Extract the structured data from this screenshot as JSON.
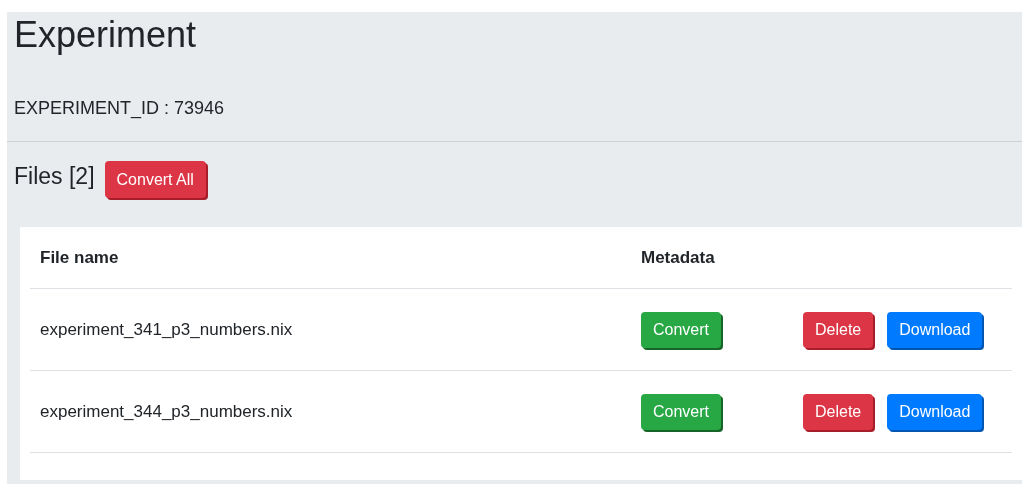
{
  "title": "Experiment",
  "experiment_id": "EXPERIMENT_ID : 73946",
  "files_heading": "Files [2]",
  "convert_all": {
    "label": "Convert All",
    "kind": "danger"
  },
  "table": {
    "columns": [
      "File name",
      "Metadata"
    ],
    "rows": [
      {
        "file_name": "experiment_341_p3_numbers.nix",
        "metadata_button": {
          "label": "Convert",
          "kind": "success"
        },
        "actions": [
          {
            "label": "Delete",
            "kind": "danger"
          },
          {
            "label": "Download",
            "kind": "primary"
          }
        ]
      },
      {
        "file_name": "experiment_344_p3_numbers.nix",
        "metadata_button": {
          "label": "Convert",
          "kind": "success"
        },
        "actions": [
          {
            "label": "Delete",
            "kind": "danger"
          },
          {
            "label": "Download",
            "kind": "primary"
          }
        ]
      }
    ]
  }
}
